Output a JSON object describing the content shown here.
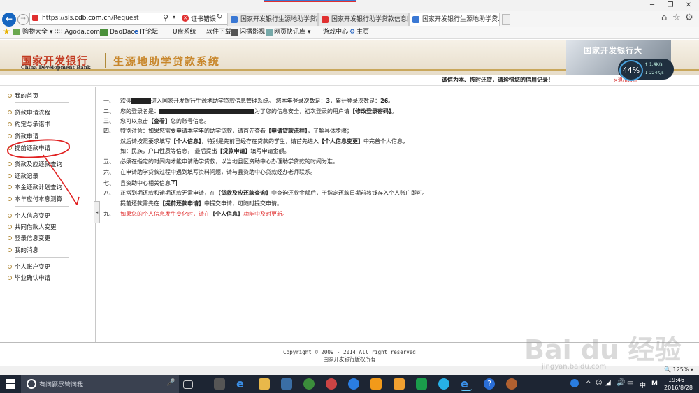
{
  "browser": {
    "url_prefix": "https://sls.",
    "url_domain": "cdb.com.cn",
    "url_path": "/Request",
    "cert_error": "证书错误",
    "tabs": [
      {
        "label": "国家开发银行生源地助学贷款..."
      },
      {
        "label": "国家开发银行助学贷款信息网"
      },
      {
        "label": "国家开发银行生源地助学贷..."
      }
    ],
    "favorites": [
      "购物大全",
      "Agoda.com",
      "DaoDao",
      "IT论坛",
      "U盘系统",
      "软件下载",
      "闪播影视",
      "网页快讯库",
      "游戏中心",
      "主页"
    ],
    "zoom": "125%"
  },
  "banner": {
    "bank_cn": "国家开发银行",
    "bank_en": "China Development Bank",
    "system_name": "生源地助学贷款系统",
    "building_text": "国家开发银行大",
    "slogan": "诚信为本、按时还贷，请珍惜您的信用记录！",
    "close_text": "×退出系统"
  },
  "net_widget": {
    "percent": "44%",
    "up": "1.4K/s",
    "down": "224K/s"
  },
  "sidebar": {
    "items": [
      "我的首页",
      "贷款申请流程",
      "约定与承诺书",
      "贷款申请",
      "提前还款申请",
      "贷款及应还款查询",
      "还款记录",
      "本金还款计划查询",
      "本年应付本息测算",
      "个人信息变更",
      "共同借款人变更",
      "登录信息变更",
      "我的消息",
      "个人账户变更",
      "毕业确认申请"
    ]
  },
  "content": {
    "l1_num": "一、",
    "l1_a": "欢迎",
    "l1_b": "进入国家开发银行生源地助学贷款信息管理系统。 您本年登录次数是：",
    "l1_c": "3",
    "l1_d": "，累计登录次数是：",
    "l1_e": "26",
    "l1_f": "。",
    "l2_num": "二、",
    "l2_a": "您的登录名是：",
    "l2_b": "为了您的信息安全，初次登录的用户请",
    "l2_c": "【修改登录密码】",
    "l2_d": "。",
    "l3_num": "三、",
    "l3_a": "您可以点击",
    "l3_b": "【查看】",
    "l3_c": "您的账号信息。",
    "l4_num": "四、",
    "l4_a": "特别注意：如果您需要申请本学年的助学贷款，请首先查看",
    "l4_b": "【申请贷款流程】",
    "l4_c": "，了解具体步骤；",
    "l4b_a": "然后请按照要求填写",
    "l4b_b": "【个人信息】",
    "l4b_c": "，特别是先前已经存在贷款的学生，请首先进入",
    "l4b_d": "【个人信息变更】",
    "l4b_e": "中完善个人信息，",
    "l4c_a": "如：民族，户口性质等信息， 最后提出",
    "l4c_b": "【贷款申请】",
    "l4c_c": "填写申请金额。",
    "l5_num": "五、",
    "l5_a": "必须在指定的时间内才能申请助学贷款，以当地县区资助中心办理助学贷款的时间为准。",
    "l6_num": "六、",
    "l6_a": "在申请助学贷款过程中遇到填写资料问题，请与县资助中心贷款经办老师联系。",
    "l7_num": "七、",
    "l7_a": "县资助中心相关信息",
    "l8_num": "八、",
    "l8_a": "正常到期还款和逾期还款无需申请，在",
    "l8_b": "【贷款及应还款查询】",
    "l8_c": "中查询还款金额后，于指定还款日期前将钱存入个人账户即可。",
    "l8b_a": "提前还款需先在",
    "l8b_b": "【提前还款申请】",
    "l8b_c": "中提交申请，可随时提交申请。",
    "l9_num": "九、",
    "l9_a": "如果您的个人信息发生变化时，请在",
    "l9_b": "【个人信息】",
    "l9_c": "功能中及时更新。"
  },
  "footer": {
    "copyright": "Copyright © 2009 - 2014 All right reserved",
    "owner": "国家开发银行版权所有"
  },
  "watermark": {
    "brand": "Bai du 经验",
    "url": "jingyan.baidu.com"
  },
  "taskbar": {
    "search_placeholder": "有问题尽管问我",
    "time": "19:46",
    "date": "2016/8/28",
    "ime": "中",
    "ime2": "M"
  }
}
